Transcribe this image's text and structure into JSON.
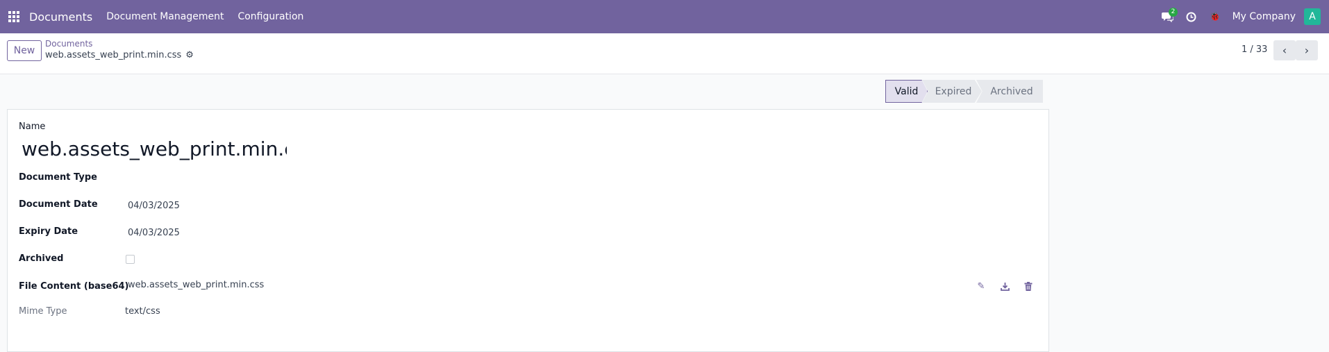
{
  "navbar": {
    "app_name": "Documents",
    "menu": [
      "Document Management",
      "Configuration"
    ],
    "icons": [
      "apps-grid-icon",
      "chat-icon",
      "clock-icon",
      "debug-icon"
    ],
    "chat_badge": "2",
    "debug_label": "?!",
    "company": "My Company",
    "avatar_letter": "A"
  },
  "control": {
    "new_label": "New",
    "breadcrumb": "Documents",
    "record_title": "web.assets_web_print.min.css",
    "pager": "1 / 33"
  },
  "statusbar": {
    "stages": [
      "Valid",
      "Expired",
      "Archived"
    ],
    "active": "Valid"
  },
  "form": {
    "name_label": "Name",
    "name_value": "web.assets_web_print.min.css",
    "document_type_label": "Document Type",
    "document_type_value": "",
    "document_date_label": "Document Date",
    "document_date_value": "04/03/2025",
    "expiry_date_label": "Expiry Date",
    "expiry_date_value": "04/03/2025",
    "archived_label": "Archived",
    "archived_checked": false,
    "file_content_label": "File Content (base64)",
    "file_content_value": "web.assets_web_print.min.css",
    "mime_type_label": "Mime Type",
    "mime_type_value": "text/css"
  },
  "colors": {
    "navbar": "#71639e",
    "accent": "#71639e",
    "avatar": "#21b799",
    "badge": "#28a745"
  }
}
